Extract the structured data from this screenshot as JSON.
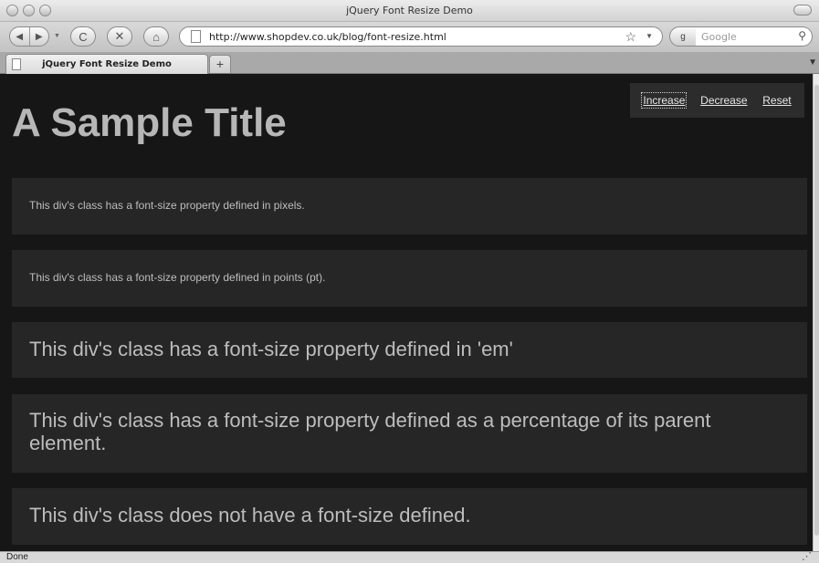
{
  "window": {
    "title": "jQuery Font Resize Demo"
  },
  "toolbar": {
    "back_glyph": "◀",
    "forward_glyph": "▶",
    "reload_glyph": "C",
    "stop_glyph": "✕",
    "home_glyph": "⌂",
    "url": "http://www.shopdev.co.uk/blog/font-resize.html",
    "star_glyph": "☆",
    "url_drop_glyph": "▼",
    "search_engine_glyph": "g",
    "search_placeholder": "Google",
    "search_glyph": "⚲"
  },
  "tabs": {
    "active_label": "jQuery Font Resize Demo",
    "new_tab_glyph": "+",
    "list_glyph": "▼"
  },
  "page": {
    "title": "A Sample Title",
    "controls": {
      "increase": "Increase",
      "decrease": "Decrease",
      "reset": "Reset"
    },
    "boxes": {
      "px": "This div's class has a font-size property defined in pixels.",
      "pt": "This div's class has a font-size property defined in points (pt).",
      "em": "This div's class has a font-size property defined in 'em'",
      "pct": "This div's class has a font-size property defined as a percentage of its parent element.",
      "none": "This div's class does not have a font-size defined."
    }
  },
  "status": {
    "text": "Done"
  }
}
